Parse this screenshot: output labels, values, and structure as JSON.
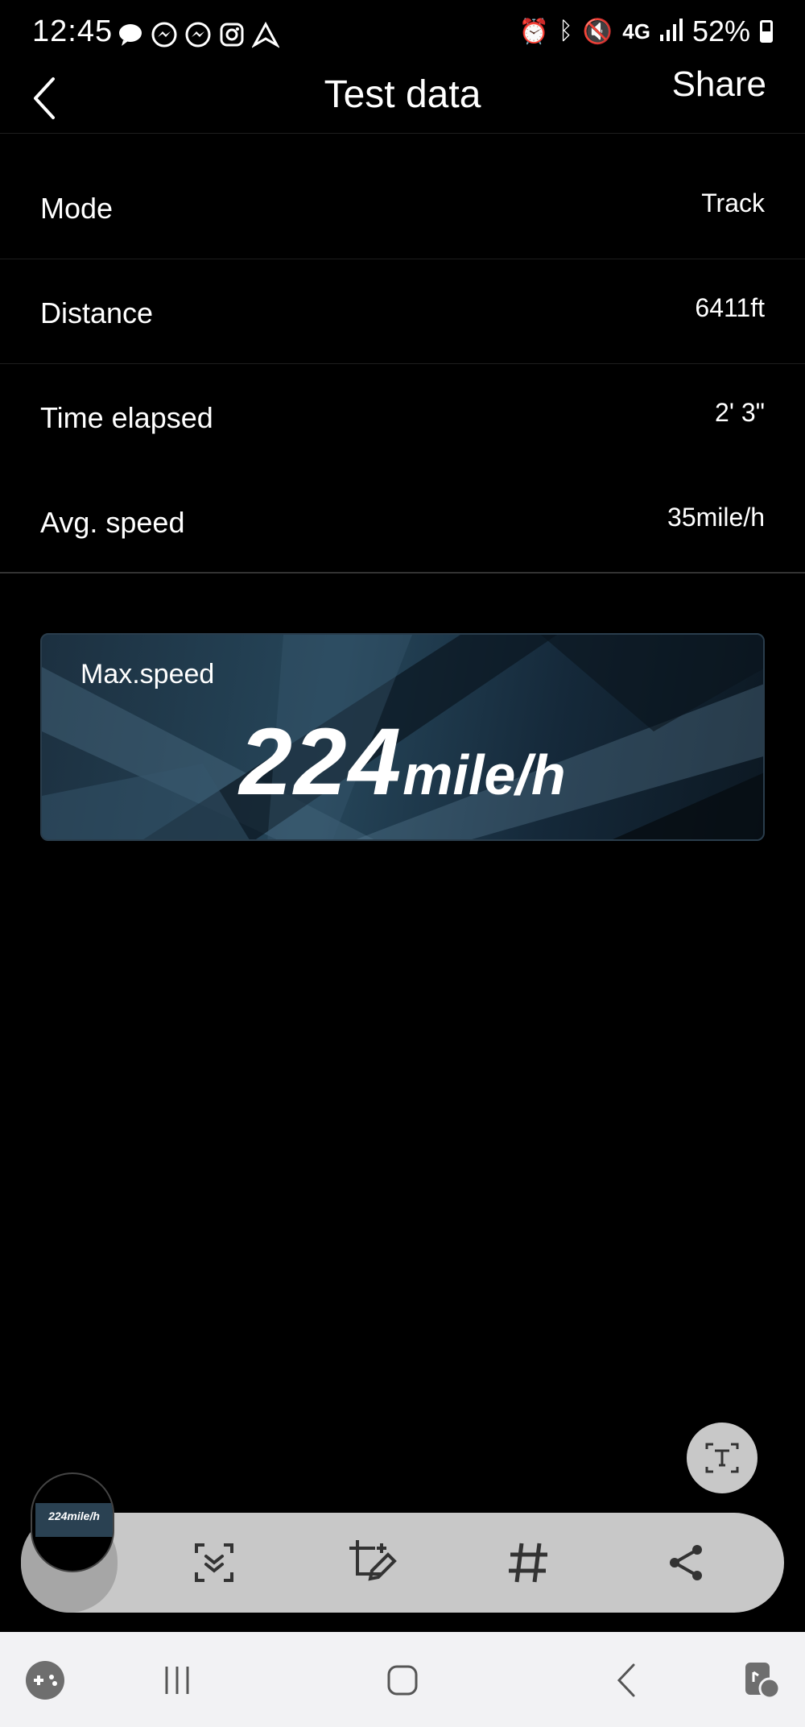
{
  "status_bar": {
    "time": "12:45",
    "left_icons": [
      "chat-bubble-icon",
      "messenger-icon",
      "messenger-icon",
      "instagram-icon",
      "arrow-app-icon"
    ],
    "network": "4G",
    "battery": "52%"
  },
  "header": {
    "title": "Test data",
    "share_label": "Share"
  },
  "rows": [
    {
      "label": "Mode",
      "value": "Track"
    },
    {
      "label": "Distance",
      "value": "6411ft"
    },
    {
      "label": "Time elapsed",
      "value": "2' 3\""
    },
    {
      "label": "Avg. speed",
      "value": "35mile/h"
    }
  ],
  "max_speed": {
    "label": "Max.speed",
    "value": "224",
    "unit": "mile/h"
  },
  "thumbnail": {
    "text": "224mile/h"
  },
  "toolbar": {
    "buttons": [
      "scroll-capture-icon",
      "crop-edit-icon",
      "hashtag-icon",
      "share-icon"
    ]
  },
  "colors": {
    "background": "#000000",
    "toolbar": "#c8c8c8",
    "card_accent": "#26465a",
    "navbar": "#f2f2f4"
  }
}
